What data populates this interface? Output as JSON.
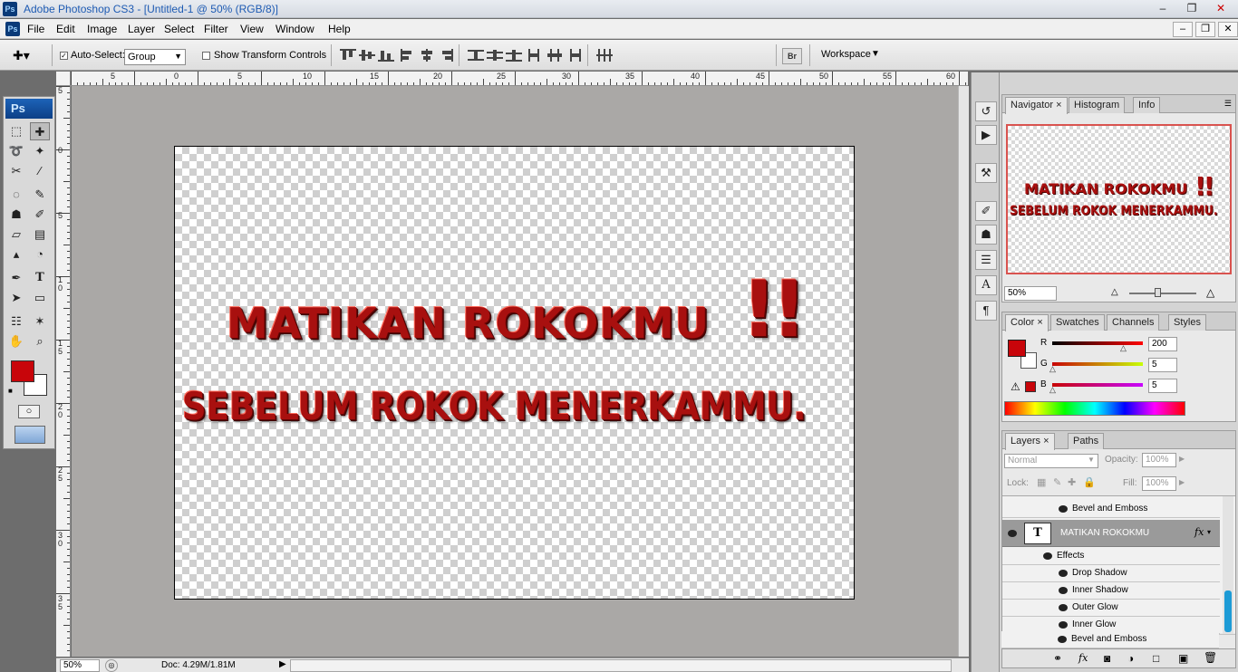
{
  "window": {
    "title": "Adobe Photoshop CS3 - [Untitled-1 @ 50% (RGB/8)]",
    "logo": "Ps",
    "controls": {
      "minimize": "–",
      "restore": "❐",
      "close": "✕"
    },
    "doc_controls": {
      "minimize": "–",
      "restore": "❐",
      "close": "✕"
    }
  },
  "menu": [
    "File",
    "Edit",
    "Image",
    "Layer",
    "Select",
    "Filter",
    "View",
    "Window",
    "Help"
  ],
  "options": {
    "auto_select_label": "Auto-Select:",
    "auto_select_checked": true,
    "auto_select_value": "Group",
    "show_transform_label": "Show Transform Controls",
    "show_transform_checked": false,
    "workspace_label": "Workspace"
  },
  "toolbox": {
    "badge": "Ps",
    "type_tool": "T",
    "foreground_color": "#c8050a",
    "background_color": "#ffffff"
  },
  "rulers": {
    "horizontal": [
      "5",
      "0",
      "5",
      "10",
      "15",
      "20",
      "25",
      "30",
      "35",
      "40",
      "45",
      "50",
      "55",
      "60"
    ],
    "vertical": [
      "5",
      "0",
      "5",
      "1\n0",
      "1\n5",
      "2\n0",
      "2\n5",
      "3\n0",
      "3\n5"
    ]
  },
  "canvas": {
    "line1": "MATIKAN ROKOKMU",
    "exclaim": "!!",
    "line2": "SEBELUM ROKOK MENERKAMMU."
  },
  "status": {
    "zoom": "50%",
    "doc": "Doc: 4.29M/1.81M"
  },
  "navigator": {
    "tabs": [
      "Navigator",
      "Histogram",
      "Info"
    ],
    "preview_line1": "MATIKAN ROKOKMU",
    "preview_exclaim": "!!",
    "preview_line2": "SEBELUM ROKOK MENERKAMMU.",
    "zoom": "50%"
  },
  "color_panel": {
    "tabs": [
      "Color",
      "Swatches",
      "Channels",
      "Styles"
    ],
    "channels": [
      {
        "label": "R",
        "value": "200"
      },
      {
        "label": "G",
        "value": "5"
      },
      {
        "label": "B",
        "value": "5"
      }
    ],
    "foreground": "#c8050a"
  },
  "layers_panel": {
    "tabs": [
      "Layers",
      "Paths"
    ],
    "blend_mode": "Normal",
    "opacity_label": "Opacity:",
    "opacity_value": "100%",
    "lock_label": "Lock:",
    "fill_label": "Fill:",
    "fill_value": "100%",
    "top_effect": "Bevel and Emboss",
    "layer_name": "MATIKAN ROKOKMU",
    "layer_thumb": "T",
    "fx": "fx",
    "effects_label": "Effects",
    "effects": [
      "Drop Shadow",
      "Inner Shadow",
      "Outer Glow",
      "Inner Glow",
      "Bevel and Emboss"
    ]
  }
}
